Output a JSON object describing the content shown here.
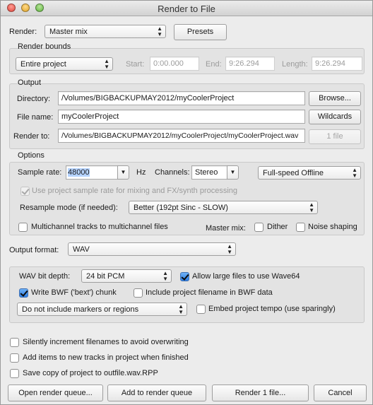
{
  "window": {
    "title": "Render to File"
  },
  "render": {
    "label": "Render:",
    "source": "Master mix",
    "presets_label": "Presets"
  },
  "bounds": {
    "title": "Render bounds",
    "selection": "Entire project",
    "start_label": "Start:",
    "start_value": "0:00.000",
    "end_label": "End:",
    "end_value": "9:26.294",
    "length_label": "Length:",
    "length_value": "9:26.294"
  },
  "output": {
    "title": "Output",
    "directory_label": "Directory:",
    "directory_value": "/Volumes/BIGBACKUPMAY2012/myCoolerProject",
    "browse_label": "Browse...",
    "filename_label": "File name:",
    "filename_value": "myCoolerProject",
    "wildcards_label": "Wildcards",
    "renderto_label": "Render to:",
    "renderto_value": "/Volumes/BIGBACKUPMAY2012/myCoolerProject/myCoolerProject.wav",
    "files_count": "1 file"
  },
  "options": {
    "title": "Options",
    "samplerate_label": "Sample rate:",
    "samplerate_value": "48000",
    "hz": "Hz",
    "channels_label": "Channels:",
    "channels_value": "Stereo",
    "speed_value": "Full-speed Offline",
    "use_project_rate_label": "Use project sample rate for mixing and FX/synth processing",
    "use_project_rate_checked": true,
    "resample_label": "Resample mode (if needed):",
    "resample_value": "Better (192pt Sinc - SLOW)",
    "multichannel_label": "Multichannel tracks to multichannel files",
    "multichannel_checked": false,
    "mastermix_label": "Master mix:",
    "dither_label": "Dither",
    "dither_checked": false,
    "noise_label": "Noise shaping",
    "noise_checked": false
  },
  "format": {
    "label": "Output format:",
    "value": "WAV"
  },
  "wav": {
    "bitdepth_label": "WAV bit depth:",
    "bitdepth_value": "24 bit PCM",
    "wave64_label": "Allow large files to use Wave64",
    "wave64_checked": true,
    "bwf_label": "Write BWF ('bext') chunk",
    "bwf_checked": true,
    "include_filename_label": "Include project filename in BWF data",
    "include_filename_checked": false,
    "markers_value": "Do not include markers or regions",
    "tempo_label": "Embed project tempo (use sparingly)",
    "tempo_checked": false
  },
  "extras": {
    "increment_label": "Silently increment filenames to avoid overwriting",
    "increment_checked": false,
    "add_items_label": "Add items to new tracks in project when finished",
    "add_items_checked": false,
    "save_copy_label": "Save copy of project to outfile.wav.RPP",
    "save_copy_checked": false
  },
  "buttons": {
    "open_queue": "Open render queue...",
    "add_queue": "Add to render queue",
    "render": "Render 1 file...",
    "cancel": "Cancel"
  },
  "icons": {
    "popup_arrows": "updown-arrows-icon",
    "combo_arrow": "chevron-down-icon",
    "checkmark": "checkmark-icon"
  }
}
